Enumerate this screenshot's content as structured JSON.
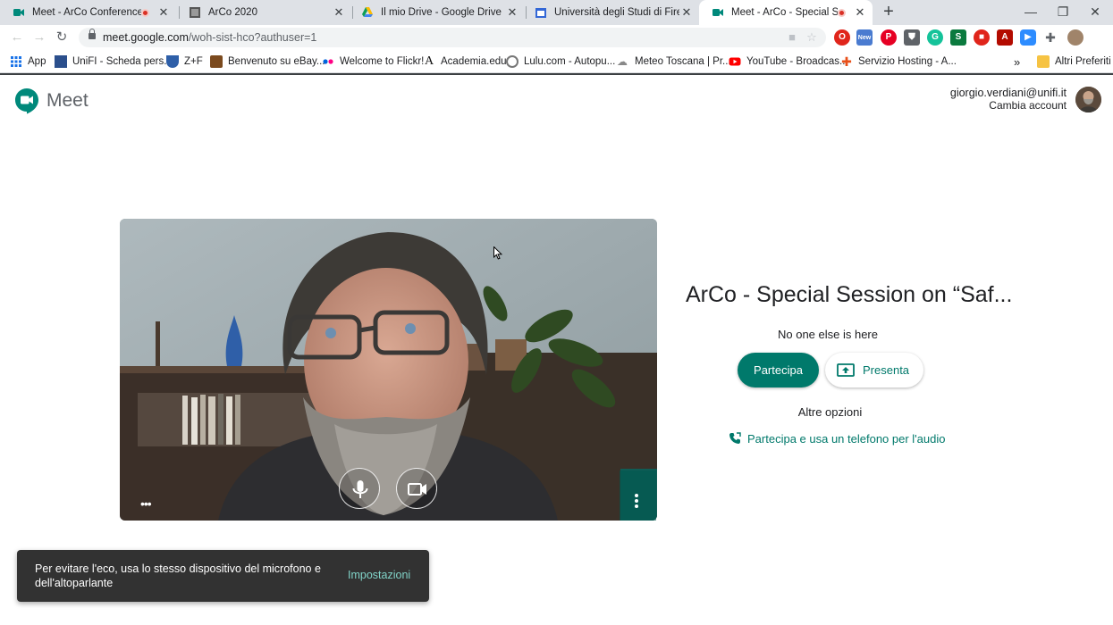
{
  "browser": {
    "tabs": [
      {
        "title": "Meet - ArCo Conference - D",
        "recording": true,
        "active": false
      },
      {
        "title": "ArCo 2020",
        "recording": false,
        "active": false
      },
      {
        "title": "Il mio Drive - Google Drive",
        "recording": false,
        "active": false
      },
      {
        "title": "Università degli Studi di Firenze",
        "recording": false,
        "active": false
      },
      {
        "title": "Meet - ArCo - Special Sessio",
        "recording": true,
        "active": true
      }
    ],
    "url_host": "meet.google.com",
    "url_path": "/woh-sist-hco?authuser=1",
    "extension_badge": "New",
    "bookmarks": [
      {
        "label": "App",
        "icon": "apps-grid-icon"
      },
      {
        "label": "UniFI - Scheda pers...",
        "icon": "unifi-icon"
      },
      {
        "label": "Z+F",
        "icon": "zf-icon"
      },
      {
        "label": "Benvenuto su eBay...",
        "icon": "ebay-icon"
      },
      {
        "label": "Welcome to Flickr!",
        "icon": "flickr-icon"
      },
      {
        "label": "Academia.edu",
        "icon": "academia-icon"
      },
      {
        "label": "Lulu.com - Autopu...",
        "icon": "lulu-icon"
      },
      {
        "label": "Meteo Toscana | Pr...",
        "icon": "meteo-icon"
      },
      {
        "label": "YouTube - Broadcas...",
        "icon": "youtube-icon"
      },
      {
        "label": "Servizio Hosting - A...",
        "icon": "hosting-icon"
      }
    ],
    "bookmarks_overflow": "»",
    "other_bookmarks": "Altri Preferiti"
  },
  "meet": {
    "product_name": "Meet",
    "account_email": "giorgio.verdiani@unifi.it",
    "switch_account": "Cambia account",
    "meeting_title": "ArCo - Special Session on “Saf...",
    "status": "No one else is here",
    "join_label": "Partecipa",
    "present_label": "Presenta",
    "other_options": "Altre opzioni",
    "phone_join": "Partecipa e usa un telefono per l'audio",
    "brand_color": "#00796b"
  },
  "snackbar": {
    "message": "Per evitare l'eco, usa lo stesso dispositivo del microfono e dell'altoparlante",
    "action": "Impostazioni"
  }
}
